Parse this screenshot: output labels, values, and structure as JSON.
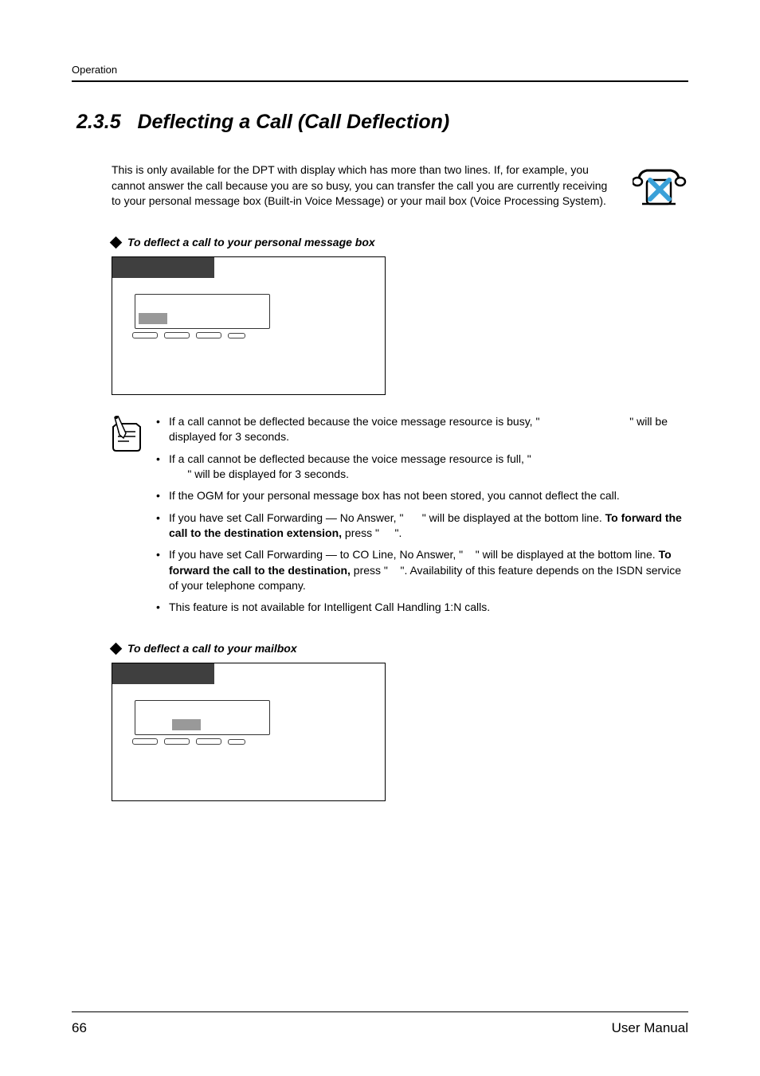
{
  "header": {
    "section_label": "Operation"
  },
  "title": {
    "number": "2.3.5",
    "text": "Deflecting a Call (Call Deflection)"
  },
  "intro": "This is only available for the DPT with display which has more than two lines. If, for example, you cannot answer the call because you are so busy, you can transfer the call you are currently receiving to your personal message box (Built-in Voice Message) or your mail box (Voice Processing System).",
  "subhead1": "To deflect a call to your personal message box",
  "subhead2": "To deflect a call to your mailbox",
  "notes": {
    "n1_a": "If a call cannot be deflected because the voice message resource is busy, \"",
    "n1_b": "\" will be displayed for 3 seconds.",
    "n2_a": "If a call cannot be deflected because the voice message resource is full, \"",
    "n2_b": "\" will be displayed for 3 seconds.",
    "n3": "If the OGM for your personal message box has not been stored, you cannot deflect the call.",
    "n4_a": "If you have set Call Forwarding — No Answer, \"",
    "n4_b": "\" will be displayed at the bottom line. ",
    "n4_bold": "To forward the call to the destination extension,",
    "n4_c": " press \"",
    "n4_d": "\".",
    "n5_a": "If you have set Call Forwarding — to CO Line, No Answer, \"",
    "n5_b": "\" will be displayed at the bottom line. ",
    "n5_bold": "To forward the call to the destination,",
    "n5_c": " press \"",
    "n5_d": "\". Availability of this feature depends on the ISDN service of your telephone company.",
    "n6": "This feature is not available for Intelligent Call Handling 1:N calls."
  },
  "footer": {
    "page": "66",
    "doc": "User Manual"
  }
}
